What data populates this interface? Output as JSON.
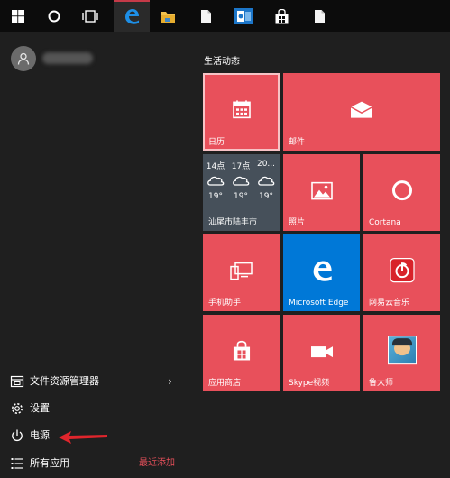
{
  "taskbar": {
    "items": [
      "windows-logo",
      "cortana",
      "task-view",
      "edge",
      "file-explorer",
      "file",
      "outlook",
      "store",
      "file"
    ]
  },
  "user": {
    "name": ""
  },
  "menu": {
    "file_explorer": "文件资源管理器",
    "settings": "设置",
    "power": "电源",
    "all_apps": "所有应用",
    "recently_added": "最近添加",
    "chevron": "›"
  },
  "tiles": {
    "group_title": "生活动态",
    "calendar": "日历",
    "mail": "邮件",
    "weather": {
      "times": [
        "14点",
        "17点",
        "20..."
      ],
      "temps": [
        "19°",
        "19°",
        "19°"
      ],
      "location": "汕尾市陆丰市"
    },
    "photos": "照片",
    "cortana": "Cortana",
    "phone_companion": "手机助手",
    "edge": "Microsoft Edge",
    "netease_music": "网易云音乐",
    "store": "应用商店",
    "skype_video": "Skype视频",
    "ludashi": "鲁大师"
  },
  "colors": {
    "tile_red": "#e8505b",
    "edge_blue": "#0078d7",
    "weather_gray": "#46505a",
    "accent_red": "#e8505b",
    "start_bg": "#1f1f1f"
  }
}
